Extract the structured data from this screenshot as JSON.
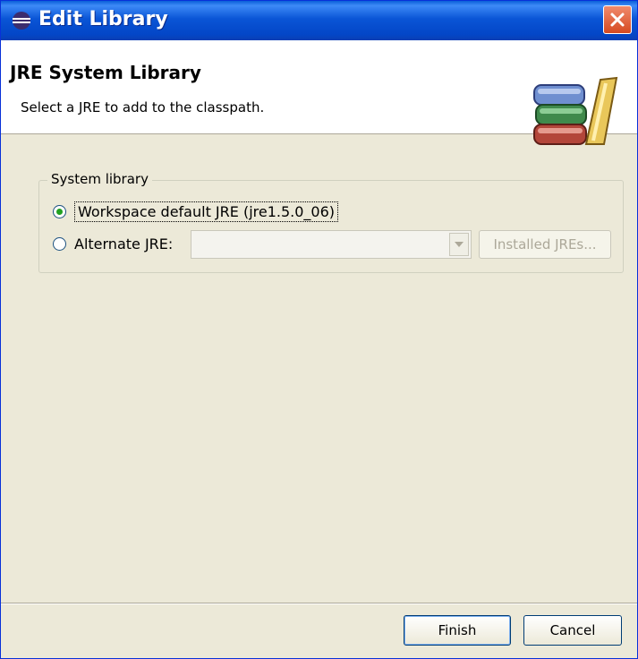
{
  "window": {
    "title": "Edit Library",
    "close_icon": "close-icon"
  },
  "header": {
    "title": "JRE System Library",
    "description": "Select a JRE to add to the classpath.",
    "icon": "library-books-icon"
  },
  "system_library": {
    "group_label": "System library",
    "options": [
      {
        "label": "Workspace default JRE (jre1.5.0_06)",
        "selected": true
      },
      {
        "label": "Alternate JRE:",
        "selected": false
      }
    ],
    "alternate_jre_value": "",
    "installed_jres_label": "Installed JREs..."
  },
  "buttons": {
    "finish": "Finish",
    "cancel": "Cancel"
  },
  "colors": {
    "titlebar": "#0a55d6",
    "dialog_bg": "#ece9d8",
    "header_bg": "#ffffff"
  }
}
